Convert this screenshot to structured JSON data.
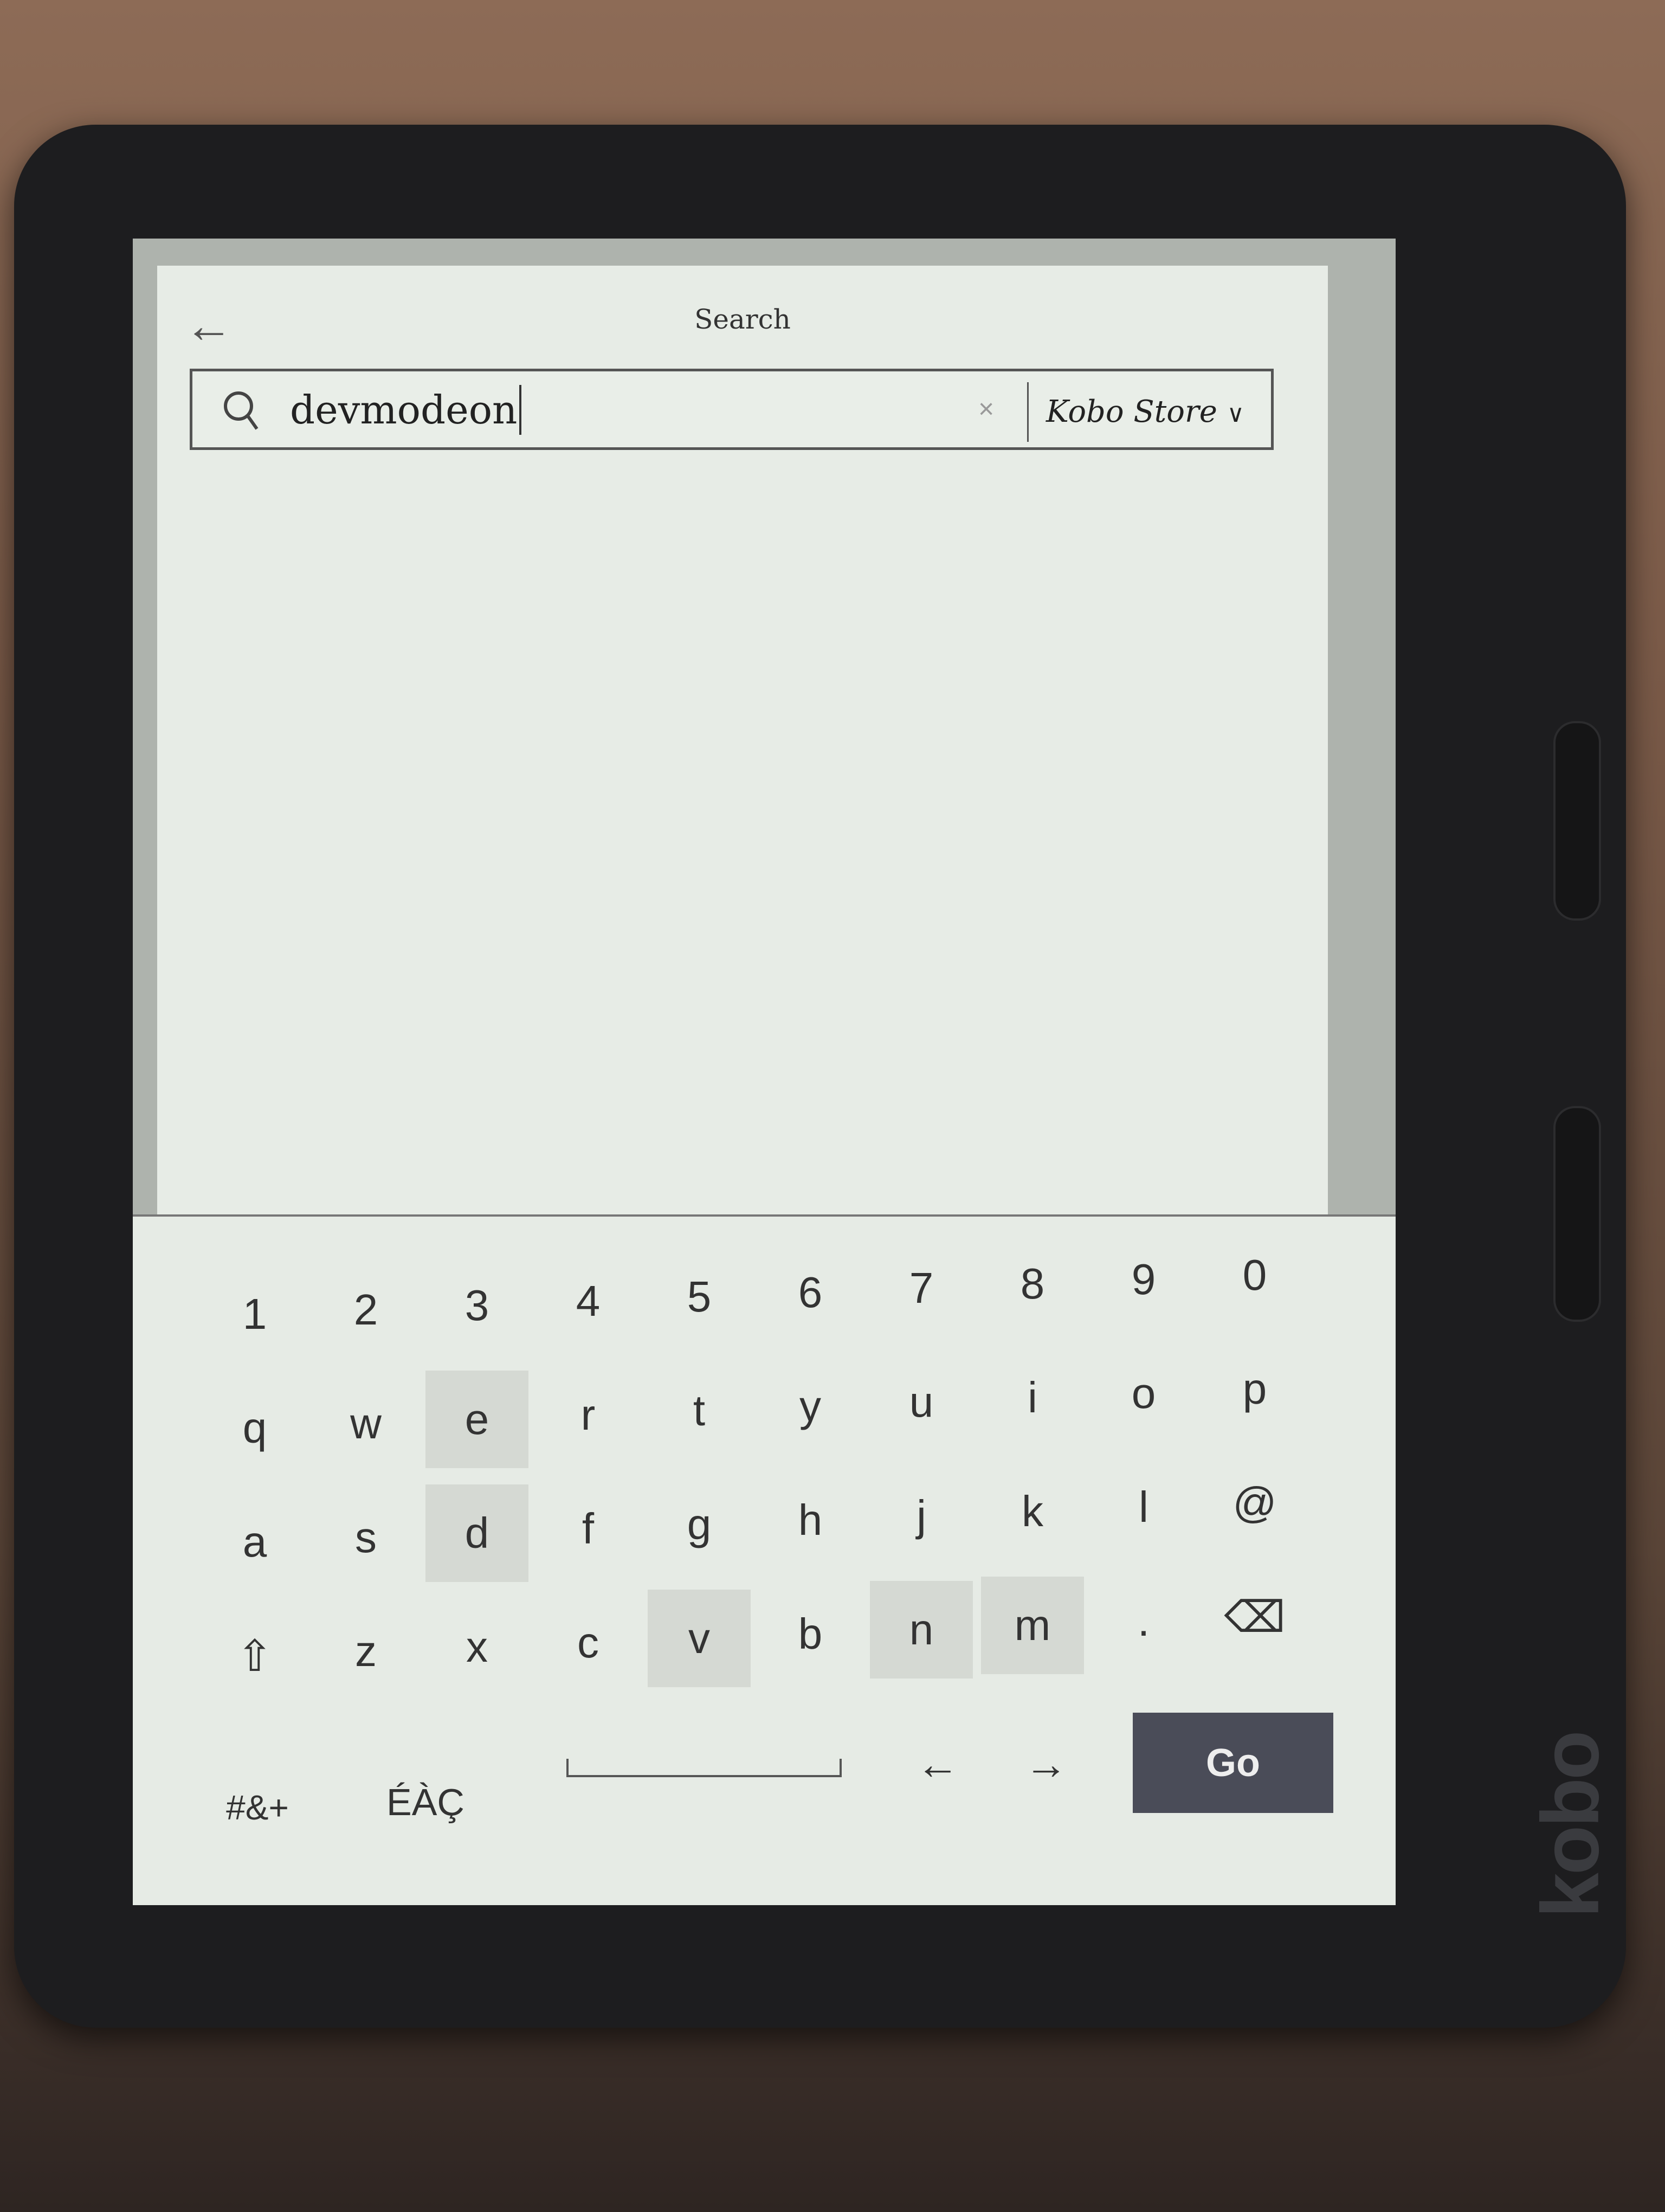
{
  "header": {
    "back_icon": "arrow-left-icon",
    "title": "Search"
  },
  "search": {
    "query": "devmodeon",
    "clear_label": "×",
    "scope": "Kobo Store",
    "scope_chevron": "∨"
  },
  "keyboard": {
    "rows": [
      [
        "1",
        "2",
        "3",
        "4",
        "5",
        "6",
        "7",
        "8",
        "9",
        "0"
      ],
      [
        "q",
        "w",
        "e",
        "r",
        "t",
        "y",
        "u",
        "i",
        "o",
        "p"
      ],
      [
        "a",
        "s",
        "d",
        "f",
        "g",
        "h",
        "j",
        "k",
        "l",
        "@"
      ],
      [
        "⇧",
        "z",
        "x",
        "c",
        "v",
        "b",
        "n",
        "m",
        ".",
        "⌫"
      ]
    ],
    "highlighted": [
      "e",
      "d",
      "v",
      "n",
      "m"
    ],
    "symbols_label": "#&+",
    "accents_label": "ÉÀÇ",
    "left_arrow": "←",
    "right_arrow": "→",
    "go_label": "Go"
  },
  "device": {
    "brand": "kobo"
  }
}
